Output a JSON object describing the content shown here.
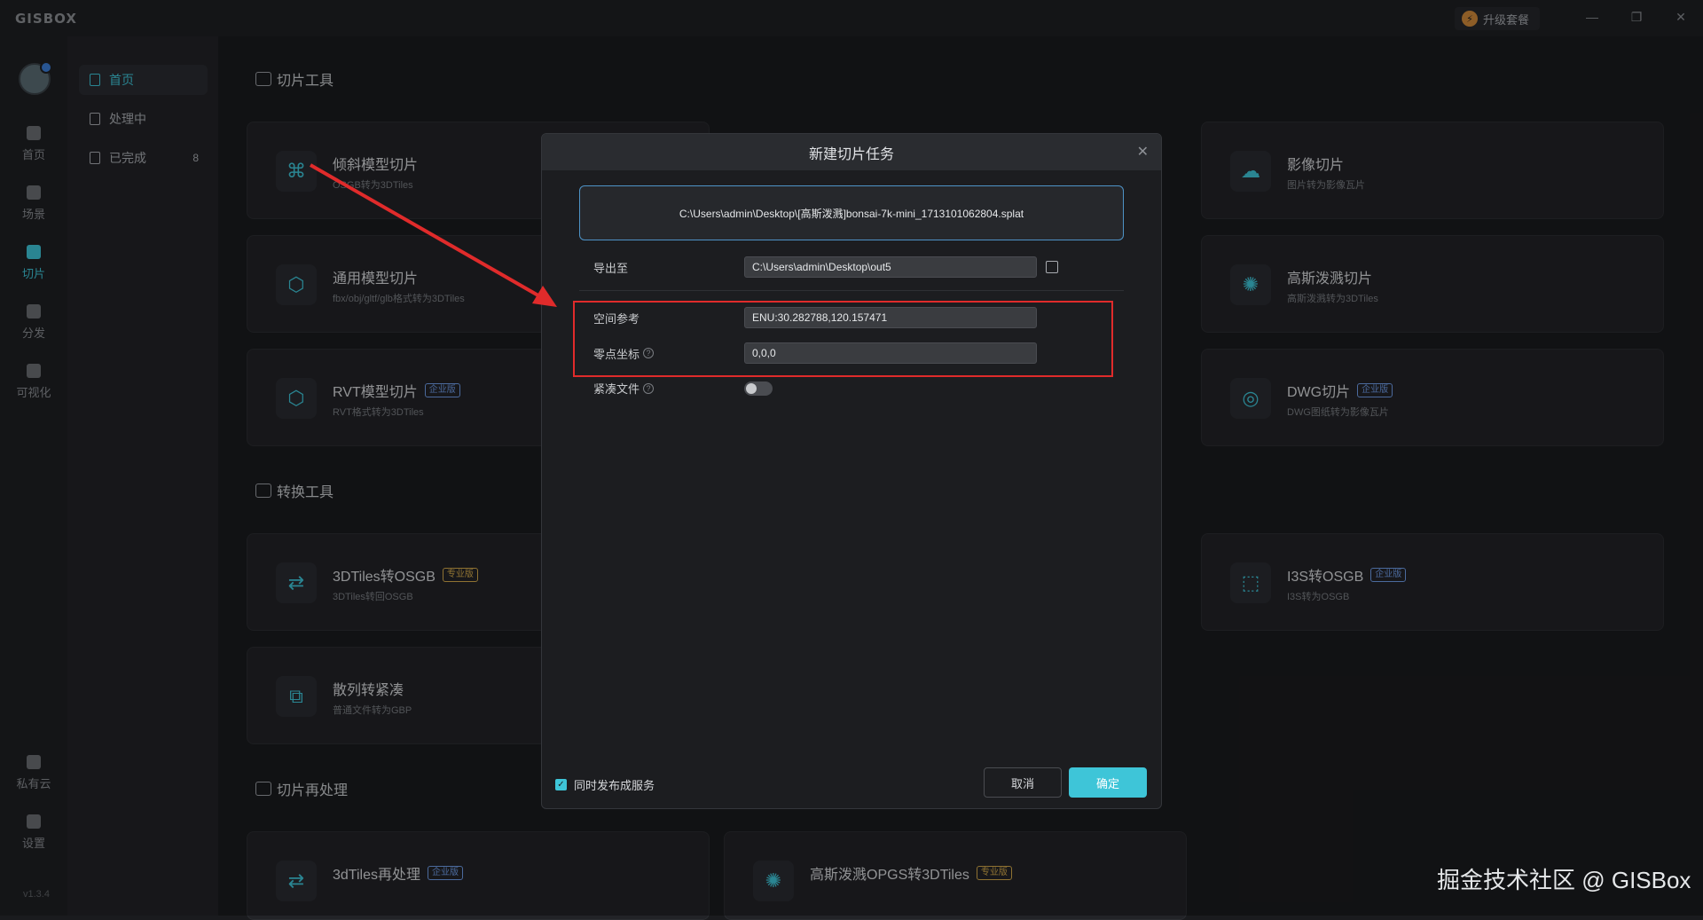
{
  "app": {
    "logo": "GISBOX",
    "upgrade_label": "升级套餐",
    "version": "v1.3.4"
  },
  "rail": [
    {
      "label": "首页",
      "icon": "home-icon"
    },
    {
      "label": "场景",
      "icon": "scene-icon"
    },
    {
      "label": "切片",
      "icon": "slice-icon"
    },
    {
      "label": "分发",
      "icon": "distribute-icon"
    },
    {
      "label": "可视化",
      "icon": "visualize-icon"
    },
    {
      "label": "私有云",
      "icon": "private-cloud-icon"
    },
    {
      "label": "设置",
      "icon": "settings-icon"
    }
  ],
  "subnav": [
    {
      "label": "首页"
    },
    {
      "label": "处理中"
    },
    {
      "label": "已完成",
      "count": "8"
    }
  ],
  "sections": {
    "slice_tools": "切片工具",
    "convert_tools": "转换工具",
    "reprocess": "切片再处理"
  },
  "cards": {
    "oblique": {
      "title": "倾斜模型切片",
      "sub": "OSGB转为3DTiles"
    },
    "general": {
      "title": "通用模型切片",
      "sub": "fbx/obj/gltf/glb格式转为3DTiles"
    },
    "rvt": {
      "title": "RVT模型切片",
      "sub": "RVT格式转为3DTiles",
      "badge": "企业版"
    },
    "image": {
      "title": "影像切片",
      "sub": "图片转为影像瓦片"
    },
    "gauss": {
      "title": "高斯泼溅切片",
      "sub": "高斯泼溅转为3DTiles"
    },
    "dwg": {
      "title": "DWG切片",
      "sub": "DWG图纸转为影像瓦片",
      "badge": "企业版"
    },
    "tiles2osgb": {
      "title": "3DTiles转OSGB",
      "sub": "3DTiles转回OSGB",
      "badge": "专业版"
    },
    "i3s2osgb": {
      "title": "I3S转OSGB",
      "sub": "I3S转为OSGB",
      "badge": "企业版"
    },
    "scatter": {
      "title": "散列转紧凑",
      "sub": "普通文件转为GBP"
    },
    "tiles_re": {
      "title": "3dTiles再处理",
      "badge": "企业版"
    },
    "gauss_opgs": {
      "title": "高斯泼溅OPGS转3DTiles",
      "badge": "专业版"
    }
  },
  "dialog": {
    "title": "新建切片任务",
    "file_path": "C:\\Users\\admin\\Desktop\\[高斯泼溅]bonsai-7k-mini_1713101062804.splat",
    "export_label": "导出至",
    "export_value": "C:\\Users\\admin\\Desktop\\out5",
    "spatial_label": "空间参考",
    "spatial_value": "ENU:30.282788,120.157471",
    "origin_label": "零点坐标",
    "origin_value": "0,0,0",
    "compact_label": "紧凑文件",
    "compact_on": false,
    "publish_label": "同时发布成服务",
    "publish_checked": true,
    "cancel": "取消",
    "confirm": "确定"
  },
  "watermark": "掘金技术社区 @ GISBox",
  "colors": {
    "accent": "#3ec5d8",
    "annotation_red": "#e02b2b"
  }
}
